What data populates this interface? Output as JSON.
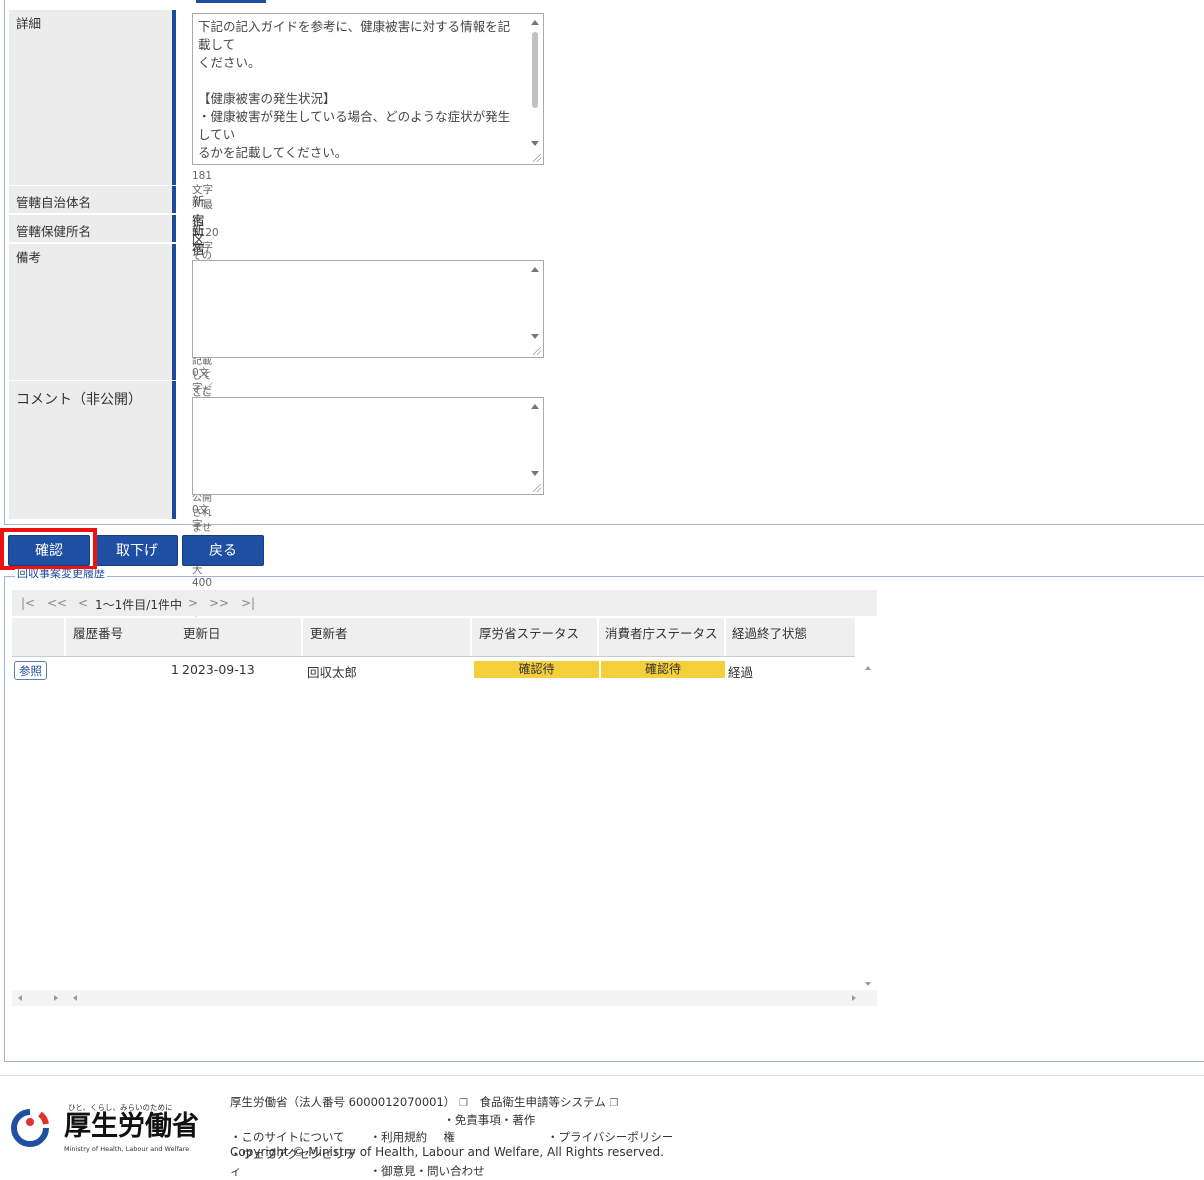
{
  "form": {
    "details": {
      "label": "詳細",
      "text": "下記の記入ガイドを参考に、健康被害に対する情報を記載して\nください。\n\n【健康被害の発生状況】\n・健康被害が発生している場合、どのような症状が発生してい\nるかを記載してください。\n（例）腹痛、嘔吐、発熱など\n・健康被害は発生していないが、想定される健康被害の内容に\n　記載してください。",
      "counter": "181文字／最大5120文字"
    },
    "municipality": {
      "label": "管轄自治体名",
      "value": "新宿区"
    },
    "health_center": {
      "label": "管轄保健所名",
      "value": "新宿区保健所"
    },
    "remarks": {
      "label": "備考",
      "hint": "その他、記載事項などがあれば記載してください。",
      "value": "",
      "counter": "0文字／最大5120文字"
    },
    "comment": {
      "label": "コメント（非公開）",
      "hint": "ここに記入されたコメントは、公開されません。",
      "value": "",
      "counter": "0文字／最大400文字"
    }
  },
  "buttons": {
    "confirm": "確認",
    "withdraw": "取下げ",
    "back": "戻る"
  },
  "history": {
    "legend": "回収事案変更履歴",
    "pager": {
      "first": "|<",
      "prev_page": "<<",
      "prev": "<",
      "range": "1～1件目/1件中",
      "next": ">",
      "next_page": ">>",
      "last": ">|"
    },
    "columns": [
      "履歴番号",
      "更新日",
      "更新者",
      "厚労省ステータス",
      "消費者庁ステータス",
      "経過終了状態"
    ],
    "rows": [
      {
        "action": "参照",
        "number": "1",
        "date": "2023-09-13",
        "updater": "回収太郎",
        "mhlw_status": "確認待",
        "caa_status": "確認待",
        "end_state": "経過"
      }
    ]
  },
  "footer": {
    "logo_tagline": "ひと、くらし、みらいのために",
    "logo_name": "厚生労働省",
    "logo_en": "Ministry of Health, Labour and Welfare",
    "org": "厚生労働省（法人番号 6000012070001）",
    "system": "食品衛生申請等システム",
    "links_row1": [
      "・このサイトについて",
      "・利用規約",
      "・免責事項・著作権",
      "・プライバシーポリシー"
    ],
    "links_row2": [
      "・ウェブアクセシビリティ",
      "・御意見・問い合わせ"
    ],
    "copyright": "Copyright © Ministry of Health, Labour and Welfare, All Rights reserved."
  },
  "colors": {
    "primary_button": "#1e4fa3",
    "status_pending": "#f5cf3a",
    "highlight": "#e11111"
  }
}
